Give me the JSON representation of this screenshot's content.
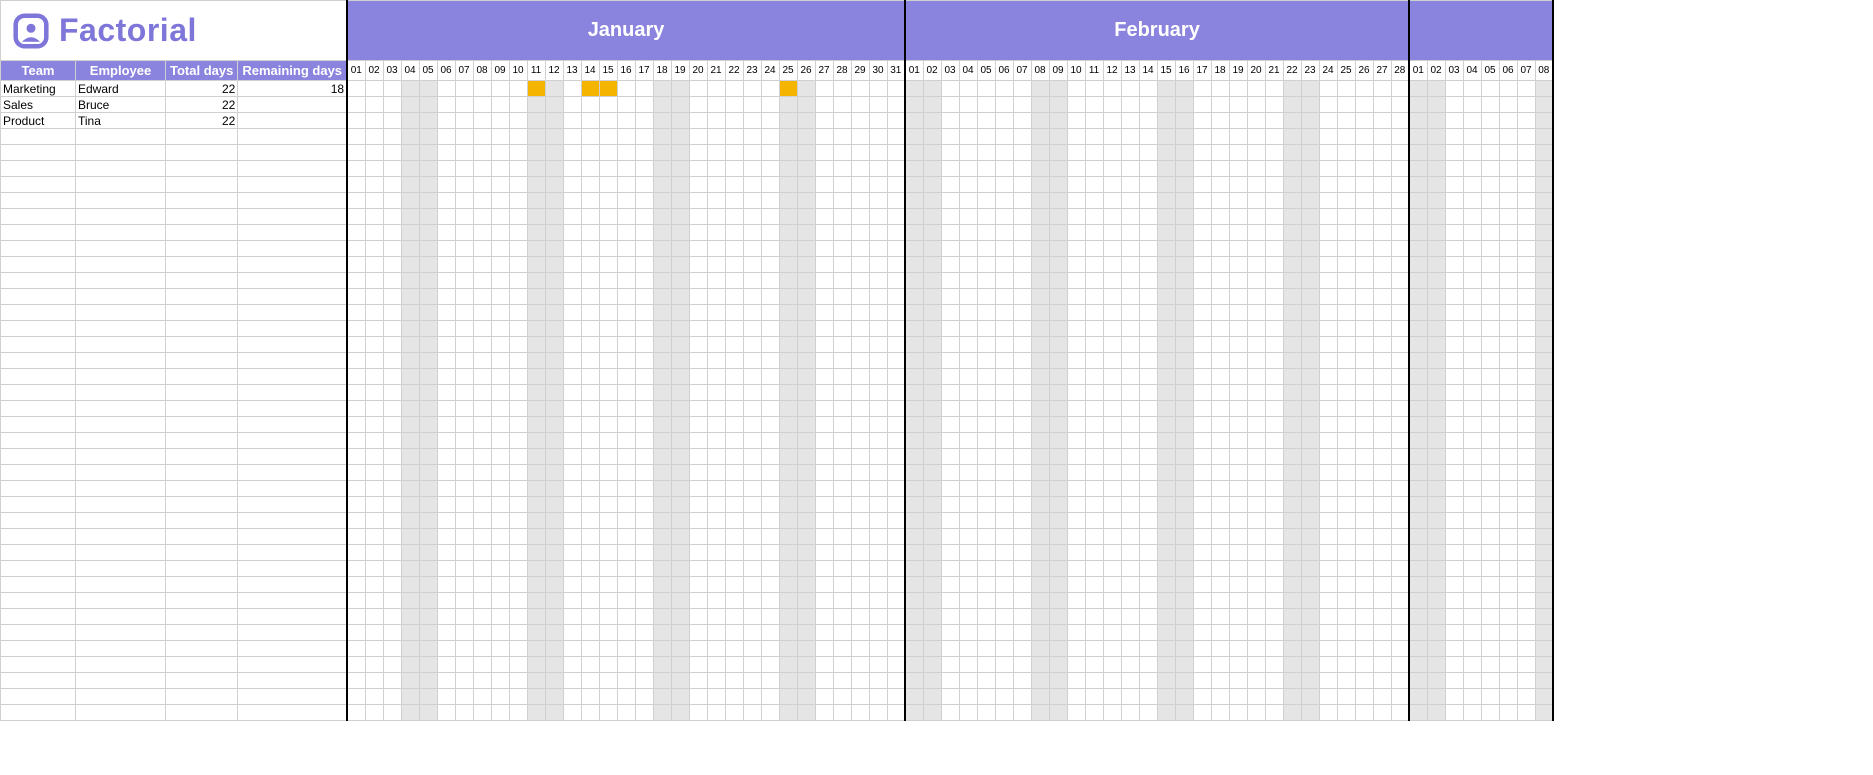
{
  "brand": {
    "name": "Factorial",
    "accent": "#7e76d8",
    "header_bg": "#8a84de"
  },
  "columns": {
    "team": "Team",
    "employee": "Employee",
    "total": "Total days",
    "remaining": "Remaining days"
  },
  "months": [
    {
      "name": "January",
      "days": 31,
      "weekends": [
        4,
        5,
        11,
        12,
        18,
        19,
        25,
        26
      ]
    },
    {
      "name": "February",
      "days": 28,
      "weekends": [
        1,
        2,
        8,
        9,
        15,
        16,
        22,
        23
      ]
    },
    {
      "name": "",
      "days": 8,
      "partial": true,
      "weekends": [
        1,
        2,
        8
      ]
    }
  ],
  "employees": [
    {
      "team": "Marketing",
      "name": "Edward",
      "total": 22,
      "remaining": 18,
      "bookings": [
        {
          "month": 0,
          "days": [
            11,
            14,
            15,
            25
          ]
        }
      ]
    },
    {
      "team": "Sales",
      "name": "Bruce",
      "total": 22,
      "remaining": "",
      "bookings": []
    },
    {
      "team": "Product",
      "name": "Tina",
      "total": 22,
      "remaining": "",
      "bookings": []
    }
  ],
  "empty_rows": 37
}
